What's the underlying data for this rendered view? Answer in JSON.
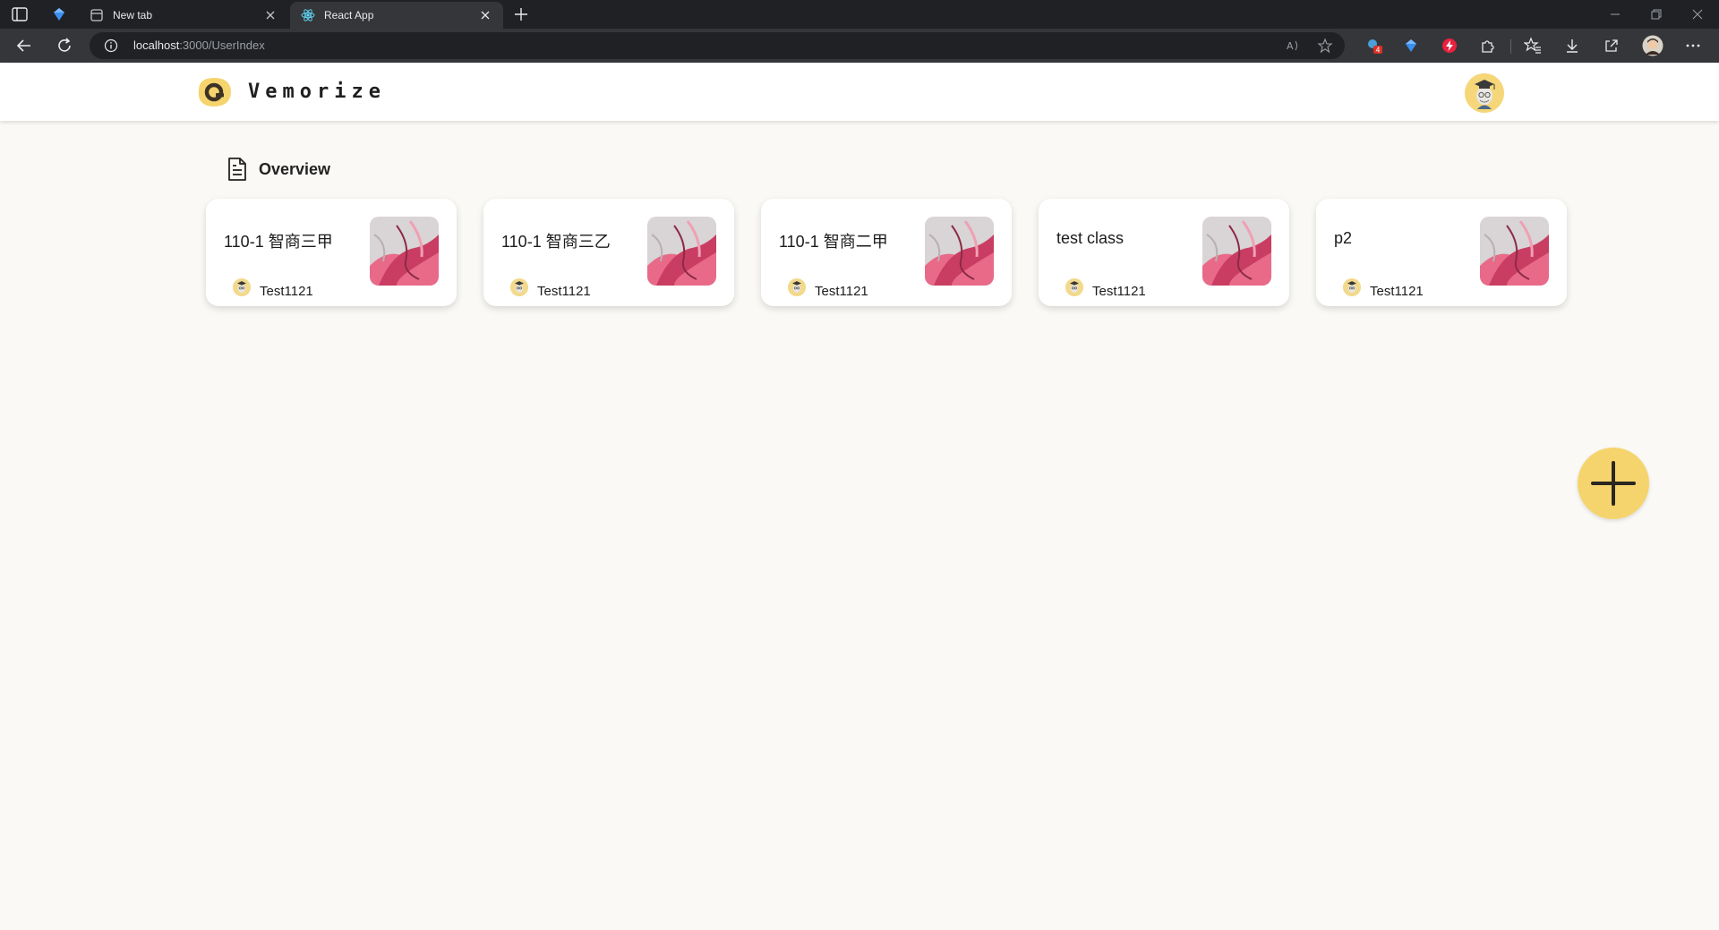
{
  "browser": {
    "tabs": [
      {
        "title": "New tab",
        "active": false
      },
      {
        "title": "React App",
        "active": true
      }
    ],
    "url": {
      "host": "localhost",
      "path": ":3000/UserIndex"
    },
    "extension_badge": "4"
  },
  "app": {
    "brand": "Vemorize",
    "accent_color": "#f6d46d",
    "background_color": "#faf9f5"
  },
  "overview": {
    "title": "Overview",
    "icon": "document-icon"
  },
  "classes": [
    {
      "name": "110-1 智商三甲",
      "owner": "Test1121"
    },
    {
      "name": "110-1 智商三乙",
      "owner": "Test1121"
    },
    {
      "name": "110-1 智商二甲",
      "owner": "Test1121"
    },
    {
      "name": "test class",
      "owner": "Test1121"
    },
    {
      "name": "p2",
      "owner": "Test1121"
    }
  ],
  "fab": {
    "icon": "plus-icon"
  }
}
